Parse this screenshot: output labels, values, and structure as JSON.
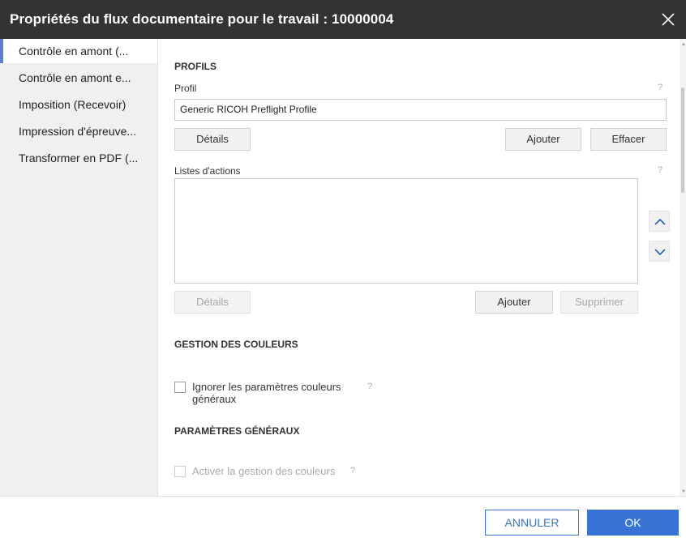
{
  "dialog": {
    "title": "Propriétés du flux documentaire pour le travail : 10000004",
    "close_icon": "close-icon"
  },
  "sidebar": {
    "items": [
      {
        "label": "Contrôle en amont (...",
        "active": true
      },
      {
        "label": "Contrôle en amont e...",
        "active": false
      },
      {
        "label": "Imposition (Recevoir)",
        "active": false
      },
      {
        "label": "Impression d'épreuve...",
        "active": false
      },
      {
        "label": "Transformer en PDF (...",
        "active": false
      }
    ]
  },
  "profiles": {
    "section_title": "PROFILS",
    "profile_label": "Profil",
    "help": "?",
    "profile_value": "Generic RICOH Preflight Profile",
    "details_button": "Détails",
    "add_button": "Ajouter",
    "clear_button": "Effacer"
  },
  "action_lists": {
    "label": "Listes d'actions",
    "help": "?",
    "details_button": "Détails",
    "add_button": "Ajouter",
    "delete_button": "Supprimer",
    "move_up_icon": "chevron-up-icon",
    "move_down_icon": "chevron-down-icon"
  },
  "color_management": {
    "section_title": "GESTION DES COULEURS",
    "ignore_general_line1": "Ignorer les paramètres couleurs",
    "ignore_general_line2": "généraux",
    "ignore_general_checked": false,
    "help": "?"
  },
  "general_settings": {
    "section_title": "PARAMÈTRES GÉNÉRAUX",
    "enable_color_mgmt": "Activer la gestion des couleurs",
    "enable_color_mgmt_checked": false,
    "help": "?"
  },
  "footer": {
    "cancel_label": "ANNULER",
    "ok_label": "OK"
  },
  "colors": {
    "titlebar": "#333333",
    "accent": "#3a73d6",
    "sidebar_active_marker": "#5b7fcc"
  }
}
